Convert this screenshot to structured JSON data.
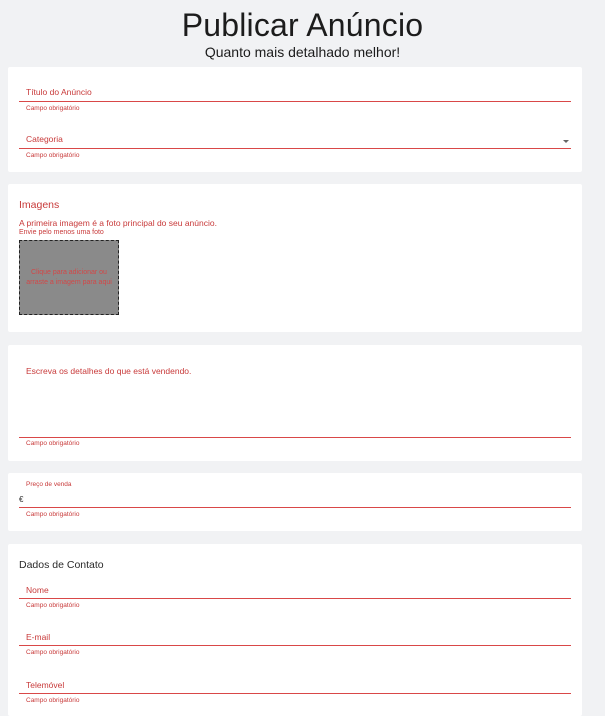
{
  "header": {
    "title": "Publicar Anúncio",
    "subtitle": "Quanto mais detalhado melhor!"
  },
  "basic": {
    "title_label": "Título do Anúncio",
    "title_helper": "Campo obrigatório",
    "category_label": "Categoria",
    "category_helper": "Campo obrigatório"
  },
  "images": {
    "heading": "Imagens",
    "note": "A primeira imagem é a foto principal do seu anúncio.",
    "helper": "Envie pelo menos uma foto",
    "dropzone_text": "Clique para adicionar ou arraste a imagem para aqui"
  },
  "description": {
    "placeholder": "Escreva os detalhes do que está vendendo.",
    "helper": "Campo obrigatório"
  },
  "price": {
    "label": "Preço de venda",
    "currency": "€",
    "helper": "Campo obrigatório"
  },
  "contact": {
    "heading": "Dados de Contato",
    "name_label": "Nome",
    "name_helper": "Campo obrigatório",
    "email_label": "E-mail",
    "email_helper": "Campo obrigatório",
    "phone_label": "Telemóvel",
    "phone_helper": "Campo obrigatório"
  },
  "colors": {
    "accent": "#d94848",
    "background": "#f1f2f4"
  }
}
